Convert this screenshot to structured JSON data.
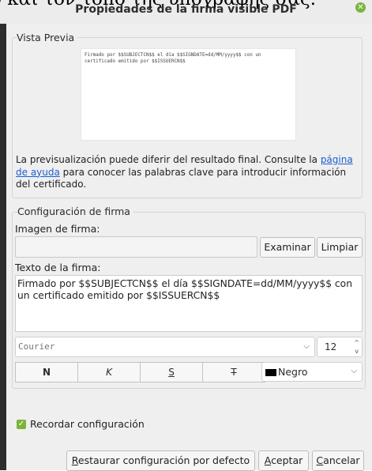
{
  "window": {
    "background_text": "ο και τον τόπο της υπογραφής σας.",
    "title": "Propiedades de la firma visible PDF",
    "close_icon": "close-icon"
  },
  "preview_group": {
    "label": "Vista Previa",
    "preview_text": "Firmado por $$SUBJECTCN$$ el día $$SIGNDATE=dd/MM/yyyy$$ con un\ncertificado emitido por $$ISSUERCN$$",
    "note_before": "La previsualización puede diferir del resultado final. Consulte la ",
    "note_link": "página de ayuda",
    "note_after": " para conocer las palabras clave para introducir información del certificado."
  },
  "config_group": {
    "label": "Configuración de firma",
    "image_label": "Imagen de firma:",
    "image_value": "",
    "examine_button": "Examinar",
    "clear_button": "Limpiar",
    "text_label": "Texto de la firma:",
    "text_value": "Firmado por $$SUBJECTCN$$ el día $$SIGNDATE=dd/MM/yyyy$$ con un certificado emitido por $$ISSUERCN$$",
    "font": "Courier",
    "font_size": "12",
    "bold_label": "N",
    "italic_label": "K",
    "underline_label": "S",
    "strike_label": "T",
    "color": "Negro"
  },
  "remember": {
    "label": "Recordar configuración",
    "checked": true
  },
  "footer": {
    "restore_prefix": "R",
    "restore_rest": "estaurar configuración por defecto",
    "accept_prefix": "A",
    "accept_rest": "ceptar",
    "cancel_prefix": "C",
    "cancel_rest": "ancelar"
  },
  "colors": {
    "accent": "#7bb33d",
    "link": "#1a5fd0"
  }
}
